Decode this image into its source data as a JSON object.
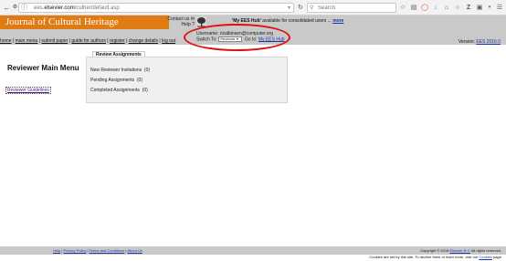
{
  "browser": {
    "url_prefix": "ees.",
    "url_domain": "elsevier.com",
    "url_path": "/culher/default.asp",
    "search_placeholder": "Search",
    "icons": [
      "back-icon",
      "info-icon",
      "reload-icon",
      "search-icon",
      "star-icon",
      "reading-list-icon",
      "pocket-icon",
      "download-icon",
      "home-icon",
      "chat-icon",
      "zotero-icon",
      "screenshot-icon",
      "menu-icon"
    ]
  },
  "header": {
    "journal_title": "Journal of Cultural Heritage",
    "contact_label": "Contact us",
    "help_label": "Help",
    "help_mark": "?",
    "hub_notice_bold": "'My EES Hub'",
    "hub_notice_text": "available for consolidated users ...",
    "hub_notice_link": "more",
    "username_label": "Username:",
    "username_value": "rizalbinsen@computer.org",
    "switch_to_label": "Switch To:",
    "switch_to_value": "Reviewer",
    "goto_label": "Go to:",
    "goto_link": "My EES Hub",
    "version_label": "Version:",
    "version_value": "EES 2016.0"
  },
  "menu": [
    "home",
    "main menu",
    "submit paper",
    "guide for authors",
    "register",
    "change details",
    "log out"
  ],
  "sidebar": {
    "title": "Reviewer Main Menu",
    "guidelines_link": "Reviewer Guidelines"
  },
  "assignments": {
    "tab_label": "Review Assignments",
    "rows": [
      {
        "label": "New Reviewer Invitations",
        "count": "(0)"
      },
      {
        "label": "Pending Assignments",
        "count": "(0)"
      },
      {
        "label": "Completed Assignments",
        "count": "(0)"
      }
    ]
  },
  "footer": {
    "links": [
      "Help",
      "Privacy Policy",
      "Terms and Conditions",
      "About Us"
    ],
    "copyright_prefix": "Copyright © 2016",
    "copyright_link": "Elsevier B.V.",
    "copyright_suffix": "All rights reserved.",
    "cookie_text": "Cookies are set by this site. To decline them or learn more, visit our",
    "cookie_link": "Cookies",
    "cookie_suffix": "page."
  },
  "colors": {
    "header_bg": "#c9c9c9",
    "logo_band": "#e07a12",
    "link": "#1a35a8",
    "annotation_oval": "#e01010"
  }
}
